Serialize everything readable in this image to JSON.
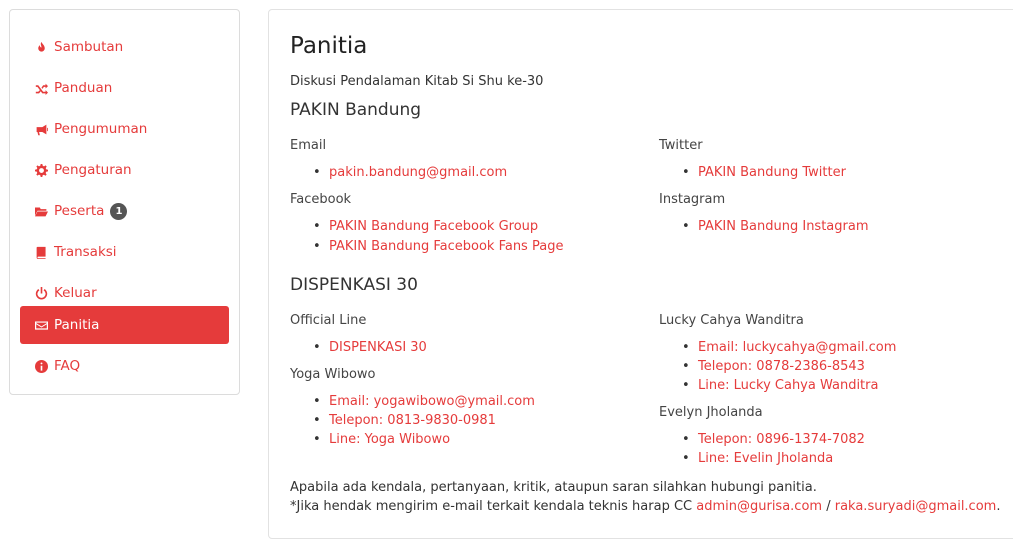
{
  "sidebar": {
    "items": [
      {
        "label": "Sambutan",
        "icon": "fire-icon"
      },
      {
        "label": "Panduan",
        "icon": "shuffle-icon"
      },
      {
        "label": "Pengumuman",
        "icon": "bullhorn-icon"
      },
      {
        "label": "Pengaturan",
        "icon": "gear-icon"
      },
      {
        "label": "Peserta",
        "icon": "folder-open-icon",
        "badge": "1"
      },
      {
        "label": "Transaksi",
        "icon": "book-icon"
      },
      {
        "label": "Keluar",
        "icon": "power-icon"
      },
      {
        "label": "Panitia",
        "icon": "envelope-icon",
        "active": true
      },
      {
        "label": "FAQ",
        "icon": "info-circle-icon"
      }
    ]
  },
  "main": {
    "title": "Panitia",
    "subtitle": "Diskusi Pendalaman Kitab Si Shu ke-30",
    "pakin": {
      "heading": "PAKIN Bandung",
      "email_label": "Email",
      "email_link": "pakin.bandung@gmail.com",
      "facebook_label": "Facebook",
      "facebook_link_1": "PAKIN Bandung Facebook Group",
      "facebook_link_2": "PAKIN Bandung Facebook Fans Page",
      "twitter_label": "Twitter",
      "twitter_link": "PAKIN Bandung Twitter",
      "instagram_label": "Instagram",
      "instagram_link": "PAKIN Bandung Instagram"
    },
    "dispenkasi": {
      "heading": "DISPENKASI 30",
      "official_label": "Official Line",
      "official_link": "DISPENKASI 30",
      "yoga_label": "Yoga Wibowo",
      "yoga_email": "Email: yogawibowo@ymail.com",
      "yoga_phone": "Telepon: 0813-9830-0981",
      "yoga_line": "Line: Yoga Wibowo",
      "lucky_label": "Lucky Cahya Wanditra",
      "lucky_email": "Email: luckycahya@gmail.com",
      "lucky_phone": "Telepon: 0878-2386-8543",
      "lucky_line": "Line: Lucky Cahya Wanditra",
      "evelyn_label": "Evelyn Jholanda",
      "evelyn_phone": "Telepon: 0896-1374-7082",
      "evelyn_line": "Line: Evelin Jholanda"
    },
    "footer": {
      "line1": "Apabila ada kendala, pertanyaan, kritik, ataupun saran silahkan hubungi panitia.",
      "line2_prefix": "*Jika hendak mengirim e-mail terkait kendala teknis harap CC ",
      "cc_email_1": "admin@gurisa.com",
      "separator": " / ",
      "cc_email_2": "raka.suryadi@gmail.com",
      "line2_suffix": "."
    }
  },
  "colors": {
    "accent": "#e53b3b",
    "badge": "#555555"
  }
}
